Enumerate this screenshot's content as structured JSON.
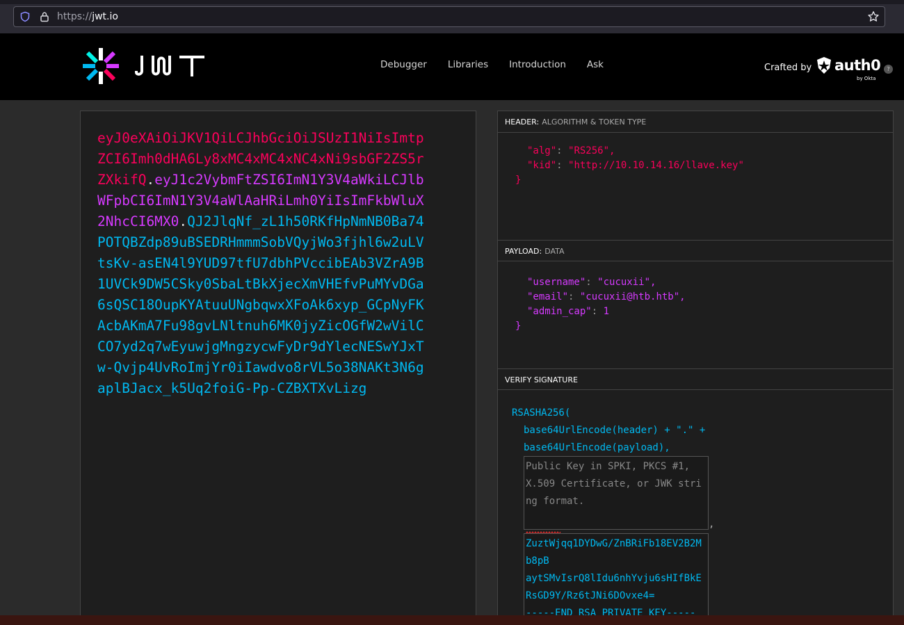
{
  "browser": {
    "url_proto": "https://",
    "url_host": "jwt.io"
  },
  "header": {
    "logo_text": "JWT",
    "nav": [
      "Debugger",
      "Libraries",
      "Introduction",
      "Ask"
    ],
    "crafted_by": "Crafted by",
    "brand": "auth0",
    "brand_sub": "by Okta",
    "help": "?"
  },
  "encoded": {
    "header_part": "eyJ0eXAiOiJKV1QiLCJhbGciOiJSUzI1NiIsImtpZCI6Imh0dHA6Ly8xMC4xMC4xNC4xNi9sbGF2ZS5rZXkifQ",
    "payload_part": "eyJ1c2VybmFtZSI6ImN1Y3V4aWkiLCJlbWFpbCI6ImN1Y3V4aWlAaHRiLmh0YiIsImFkbWluX2NhcCI6MX0",
    "signature_part": "QJ2JlqNf_zL1h50RKfHpNmNB0Ba74POTQBZdp89uBSEDRHmmmSobVQyjWo3fjhl6w2uLVtsKv-asEN4l9YUD97tfU7dbhPVccibEAb3VZrA9B1UVCk9DW5CSky0SbaLtBkXjecXmVHEfvPuMYvDGa6sQSC18OupKYAtuuUNgbqwxXFoAk6xyp_GCpNyFKAcbAKmA7Fu98gvLNltnuh6MK0jyZicOGfW2wVilCCO7yd2q7wEyuwjgMngzycwFyDr9dYlecNESwYJxTw-Qvjp4UvRoImjYr0iIawdvo8rVL5o38NAKt3N6gaplBJacx_k5Uq2foiG-Pp-CZBXTXvLizg",
    "dot": "."
  },
  "decoded": {
    "header_label": "HEADER:",
    "header_sub": "ALGORITHM & TOKEN TYPE",
    "header_lines": [
      {
        "key": "\"alg\"",
        "value": "\"RS256\","
      },
      {
        "key": "\"kid\"",
        "value": "\"http://10.10.14.16/llave.key\""
      }
    ],
    "payload_label": "PAYLOAD:",
    "payload_sub": "DATA",
    "payload_lines": [
      {
        "key": "\"username\"",
        "value": "\"cucuxii\","
      },
      {
        "key": "\"email\"",
        "value": "\"cucuxii@htb.htb\","
      },
      {
        "key": "\"admin_cap\"",
        "value": "1"
      }
    ],
    "close_brace": "}",
    "verify_label": "VERIFY SIGNATURE",
    "sig_fn": "RSASHA256(",
    "sig_line1": "base64UrlEncode(header) + \".\" +",
    "sig_line2": "base64UrlEncode(payload),",
    "public_key_placeholder": "Public Key in SPKI, PKCS #1, X.509 Certificate, or JWK string format.",
    "comma": ",",
    "private_key_value": "ZuztWjqq1DYDwG/ZnBRiFb18EV2B2Mb8pB\naytSMvIsrQ8lIdu6nhYvju6sHIfBkERsGD9Y/Rz6tJNi6DOvxe4=\n-----END RSA PRIVATE KEY-----"
  }
}
